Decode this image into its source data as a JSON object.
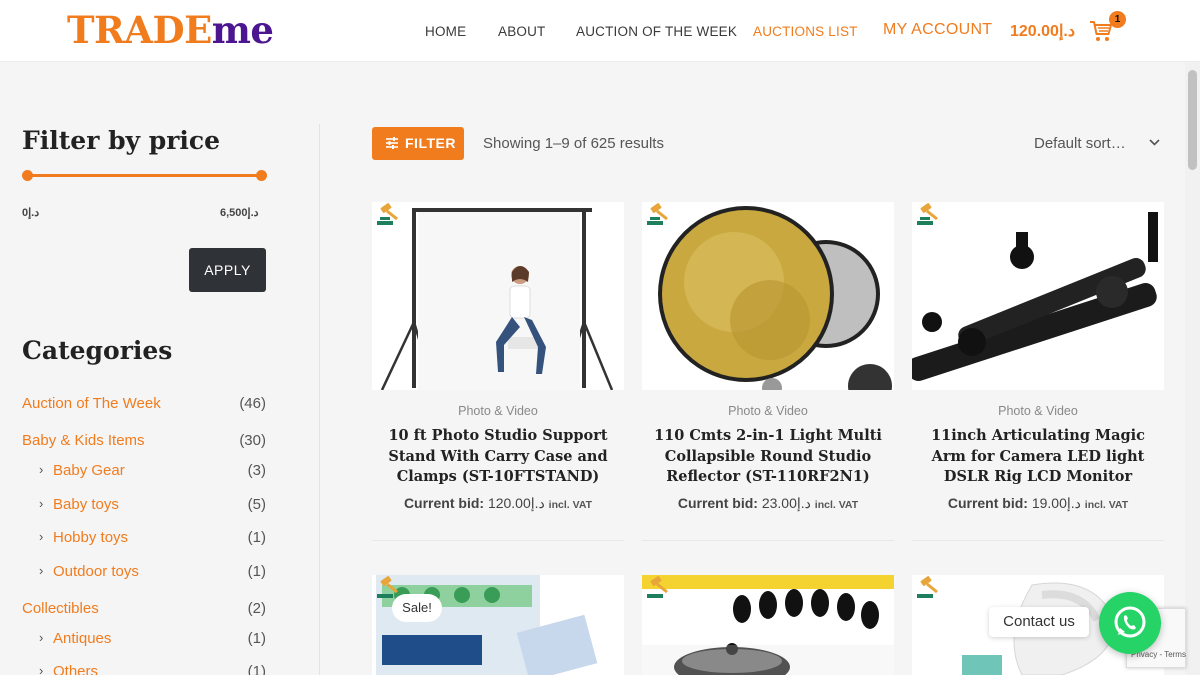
{
  "header": {
    "logo_part1": "TRADE",
    "logo_part2": "me",
    "nav": [
      {
        "label": "HOME"
      },
      {
        "label": "ABOUT"
      },
      {
        "label": "AUCTION OF THE WEEK"
      },
      {
        "label": "AUCTIONS LIST"
      },
      {
        "label": "MY ACCOUNT"
      }
    ],
    "cart_total": "120.00د.إ",
    "cart_count": "1"
  },
  "sidebar": {
    "price_filter": {
      "title": "Filter by price",
      "min_label": "0د.إ",
      "max_label": "6,500د.إ",
      "apply_label": "APPLY"
    },
    "categories": {
      "title": "Categories",
      "items": [
        {
          "name": "Auction of The Week",
          "count": "(46)",
          "sub": false
        },
        {
          "name": "Baby & Kids Items",
          "count": "(30)",
          "sub": false
        },
        {
          "name": "Baby Gear",
          "count": "(3)",
          "sub": true
        },
        {
          "name": "Baby toys",
          "count": "(5)",
          "sub": true
        },
        {
          "name": "Hobby toys",
          "count": "(1)",
          "sub": true
        },
        {
          "name": "Outdoor toys",
          "count": "(1)",
          "sub": true
        },
        {
          "name": "Collectibles",
          "count": "(2)",
          "sub": false
        },
        {
          "name": "Antiques",
          "count": "(1)",
          "sub": true
        },
        {
          "name": "Others",
          "count": "(1)",
          "sub": true
        }
      ]
    }
  },
  "toolbar": {
    "filter_label": "FILTER",
    "results_text": "Showing 1–9 of 625 results",
    "sort_label": "Default sort…"
  },
  "products": [
    {
      "category": "Photo & Video",
      "title": "10 ft Photo Studio Support Stand With Carry Case and Clamps (ST-10FTSTAND)",
      "bid_label": "Current bid:",
      "bid_value": "120.00د.إ",
      "vat": "incl. VAT"
    },
    {
      "category": "Photo & Video",
      "title": "110 Cmts 2-in-1 Light Multi Collapsible Round Studio Reflector (ST-110RF2N1)",
      "bid_label": "Current bid:",
      "bid_value": "23.00د.إ",
      "vat": "incl. VAT"
    },
    {
      "category": "Photo & Video",
      "title": "11inch Articulating Magic Arm for Camera LED light DSLR Rig LCD Monitor",
      "bid_label": "Current bid:",
      "bid_value": "19.00د.إ",
      "vat": "incl. VAT"
    }
  ],
  "sale_badge": "Sale!",
  "contact": {
    "label": "Contact us"
  },
  "recaptcha": {
    "text": "Privacy - Terms"
  },
  "colors": {
    "accent": "#f07c1e",
    "brand_purple": "#4b1690",
    "dark_button": "#2f3237",
    "whatsapp": "#25d366"
  }
}
